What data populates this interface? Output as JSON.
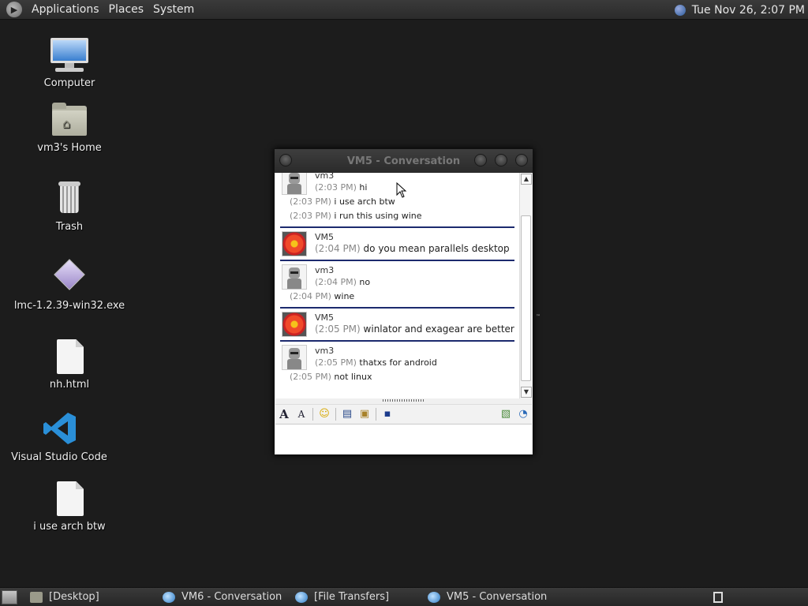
{
  "top_panel": {
    "menus": [
      "Applications",
      "Places",
      "System"
    ],
    "clock": "Tue Nov 26,  2:07 PM"
  },
  "desktop_icons": [
    {
      "label": "Computer",
      "icon": "computer-icon"
    },
    {
      "label": "vm3's Home",
      "icon": "home-folder-icon"
    },
    {
      "label": "Trash",
      "icon": "trash-icon"
    },
    {
      "label": "lmc-1.2.39-win32.exe",
      "icon": "exe-icon"
    },
    {
      "label": "nh.html",
      "icon": "document-icon"
    },
    {
      "label": "Visual Studio Code",
      "icon": "vscode-icon"
    },
    {
      "label": "i use arch btw",
      "icon": "document-icon"
    }
  ],
  "window": {
    "title": "VM5 - Conversation",
    "messages": [
      {
        "user": "vm3",
        "avatar": "robot",
        "lines": [
          {
            "time": "(2:03 PM)",
            "text": "hi"
          },
          {
            "time": "(2:03 PM)",
            "text": "i use arch btw"
          },
          {
            "time": "(2:03 PM)",
            "text": "i run this using wine"
          }
        ]
      },
      {
        "user": "VM5",
        "avatar": "flower",
        "lines": [
          {
            "time": "(2:04 PM)",
            "text": "do you mean parallels desktop"
          }
        ]
      },
      {
        "user": "vm3",
        "avatar": "robot",
        "lines": [
          {
            "time": "(2:04 PM)",
            "text": "no"
          },
          {
            "time": "(2:04 PM)",
            "text": "wine"
          }
        ]
      },
      {
        "user": "VM5",
        "avatar": "flower",
        "lines": [
          {
            "time": "(2:05 PM)",
            "text": "winlator and exagear are better"
          }
        ]
      },
      {
        "user": "vm3",
        "avatar": "robot",
        "lines": [
          {
            "time": "(2:05 PM)",
            "text": "thatxs for android"
          },
          {
            "time": "(2:05 PM)",
            "text": "not linux"
          }
        ]
      }
    ]
  },
  "taskbar": {
    "items": [
      "[Desktop]",
      "VM6 - Conversation",
      "[File Transfers]",
      "VM5 - Conversation"
    ]
  }
}
